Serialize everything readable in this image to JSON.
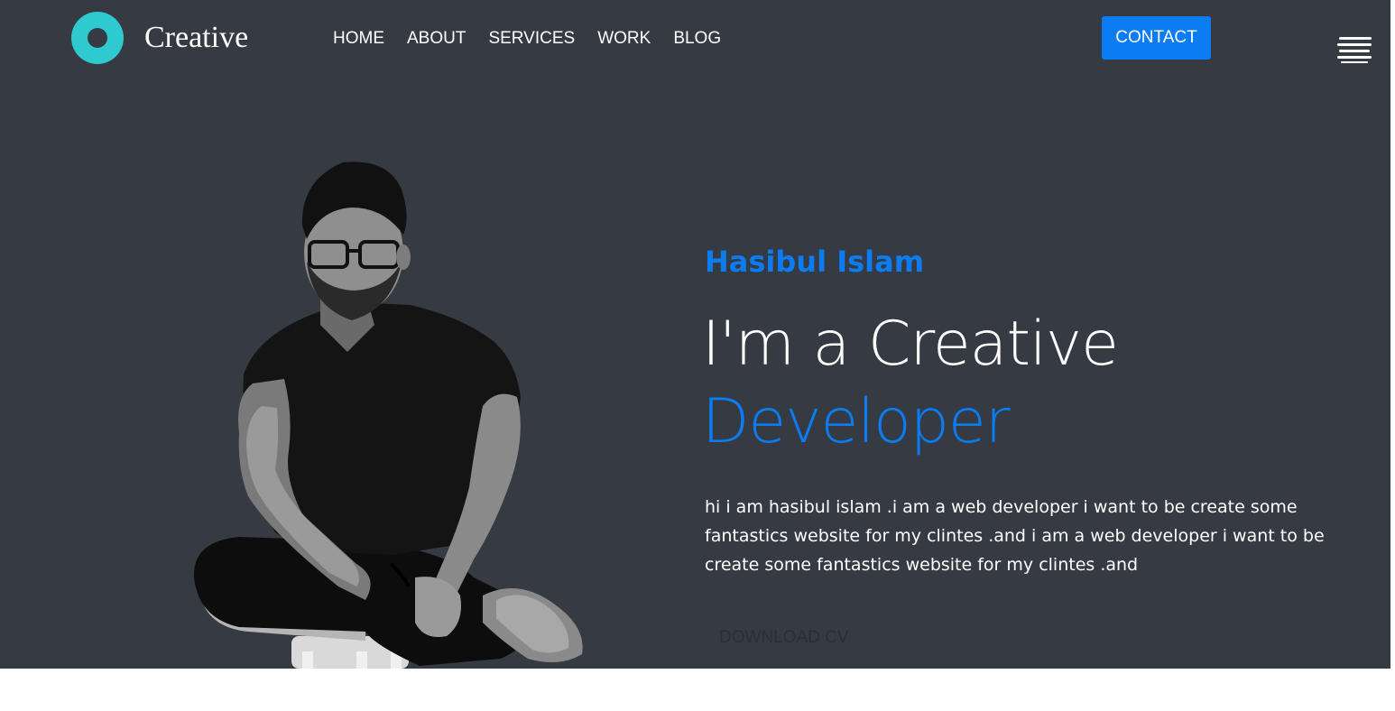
{
  "header": {
    "brand": "Creative",
    "nav": [
      {
        "label": "HOME"
      },
      {
        "label": "ABOUT"
      },
      {
        "label": "SERVICES"
      },
      {
        "label": "WORK"
      },
      {
        "label": "BLOG"
      }
    ],
    "contact_label": "CONTACT",
    "menu_icon": "hamburger-icon",
    "logo_icon": "ring-logo-icon"
  },
  "hero": {
    "name": "Hasibul Islam",
    "headline_line1": "I'm a Creative",
    "headline_line2": "Developer",
    "bio": "hi i am hasibul islam .i am a web developer i want to be create some fantastics website for my clintes .and i am a web developer i want to be create some fantastics website for my clintes .and",
    "download_label": "DOWNLOAD CV",
    "portrait_alt": "portrait-photo"
  },
  "colors": {
    "background": "#353a43",
    "accent": "#0b7cf2",
    "logo": "#2fc9d0",
    "text": "#ffffff"
  }
}
